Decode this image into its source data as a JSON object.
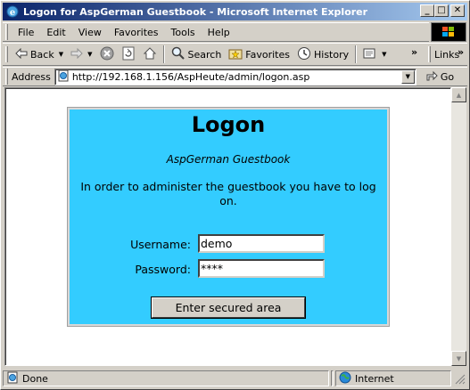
{
  "window": {
    "title": "Logon for AspGerman Guestbook - Microsoft Internet Explorer",
    "minimize": "_",
    "maximize": "□",
    "close": "✕"
  },
  "menu": {
    "items": [
      {
        "label": "File"
      },
      {
        "label": "Edit"
      },
      {
        "label": "View"
      },
      {
        "label": "Favorites"
      },
      {
        "label": "Tools"
      },
      {
        "label": "Help"
      }
    ]
  },
  "toolbar": {
    "back": "Back",
    "search": "Search",
    "favorites": "Favorites",
    "history": "History",
    "links": "Links",
    "more": "»"
  },
  "address": {
    "label": "Address",
    "url": "http://192.168.1.156/AspHeute/admin/logon.asp",
    "go": "Go"
  },
  "page": {
    "title": "Logon",
    "subtitle": "AspGerman Guestbook",
    "message": "In order to administer the guestbook you have to log on.",
    "username_label": "Username:",
    "username_value": "demo",
    "password_label": "Password:",
    "password_value": "****",
    "submit": "Enter secured area"
  },
  "status": {
    "text": "Done",
    "zone": "Internet"
  },
  "colors": {
    "panel_bg": "#33ccff",
    "title_bar": "#0a246a"
  }
}
